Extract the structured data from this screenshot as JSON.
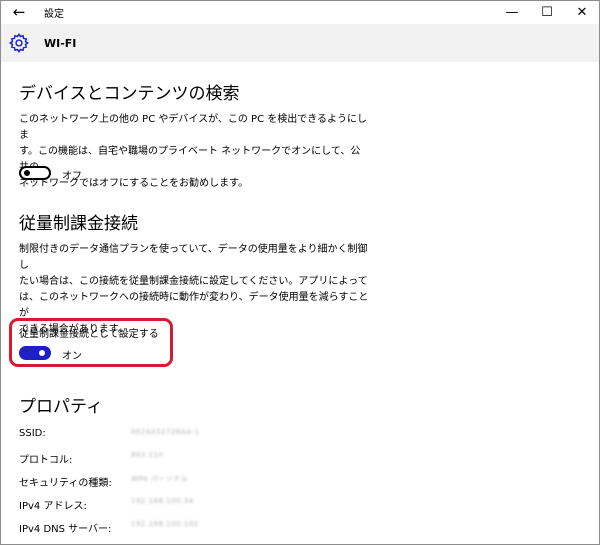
{
  "titlebar": {
    "title": "設定",
    "back_glyph": "←",
    "minimize_glyph": "—",
    "maximize_glyph": "☐",
    "close_glyph": "✕"
  },
  "header": {
    "title": "WI-FI"
  },
  "device_discovery": {
    "heading": "デバイスとコンテンツの検索",
    "description_lines": [
      "このネットワーク上の他の PC やデバイスが、この PC を検出できるようにしま",
      "す。この機能は、自宅や職場のプライベート ネットワークでオンにして、公共の",
      "ネットワークではオフにすることをお勧めします。"
    ],
    "toggle_state_label": "オフ"
  },
  "metered": {
    "heading": "従量制課金接続",
    "description_lines": [
      "制限付きのデータ通信プランを使っていて、データの使用量をより細かく制御し",
      "たい場合は、この接続を従量制課金接続に設定してください。アプリによって",
      "は、このネットワークへの接続時に動作が変わり、データ使用量を減らすことが",
      "できる場合があります。"
    ],
    "setting_label": "従量制課金接続として設定する",
    "toggle_state_label": "オン"
  },
  "properties": {
    "heading": "プロパティ",
    "rows": [
      {
        "label": "SSID:",
        "value": "0024A52728AA-1"
      },
      {
        "label": "プロトコル:",
        "value": "802.11n"
      },
      {
        "label": "セキュリティの種類:",
        "value": "WPA パーソナル"
      },
      {
        "label": "IPv4 アドレス:",
        "value": "192.168.100.34"
      },
      {
        "label": "IPv4 DNS サーバー:",
        "value": "192.168.100.102"
      }
    ]
  },
  "colors": {
    "accent": "#1f1fc8",
    "highlight": "#d31c2f",
    "header_bg": "#f2f2f2"
  }
}
